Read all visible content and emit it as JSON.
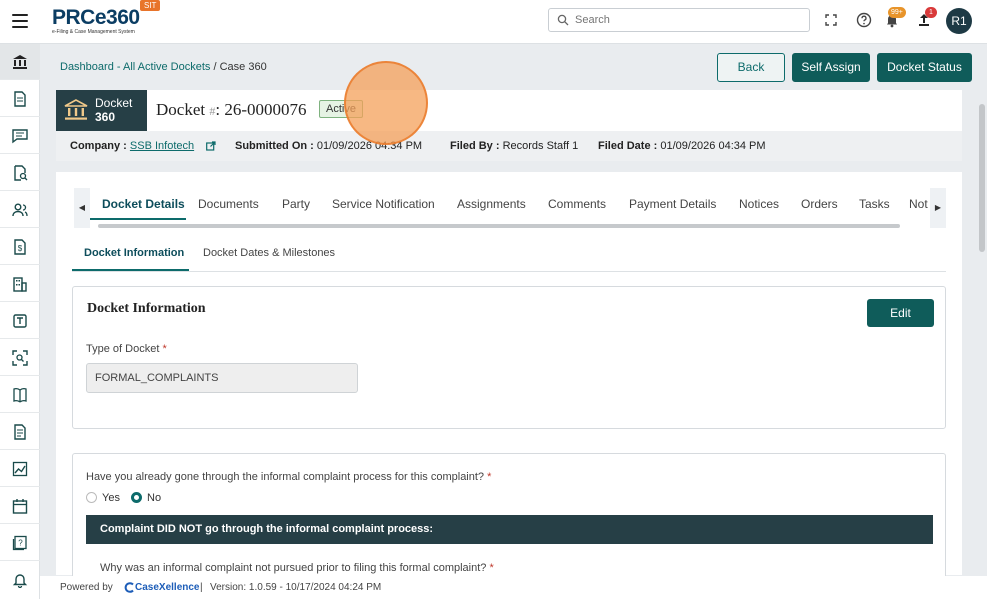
{
  "app": {
    "logo_text": "PRCe360",
    "logo_subtitle": "e-Filing & Case Management System",
    "env_badge": "SIT",
    "search_placeholder": "Search",
    "notifications_badge": "99+",
    "uploads_badge": "1",
    "user_initials": "R1"
  },
  "sidebar": {
    "items": [
      {
        "icon": "bank-icon",
        "active": true
      },
      {
        "icon": "document-icon"
      },
      {
        "icon": "chat-icon"
      },
      {
        "icon": "document-search-icon"
      },
      {
        "icon": "users-icon"
      },
      {
        "icon": "dollar-document-icon"
      },
      {
        "icon": "building-icon"
      },
      {
        "icon": "template-icon"
      },
      {
        "icon": "scan-search-icon"
      },
      {
        "icon": "book-icon"
      },
      {
        "icon": "file-text-icon"
      },
      {
        "icon": "chart-icon"
      },
      {
        "icon": "calendar-icon"
      },
      {
        "icon": "help-icon"
      },
      {
        "icon": "bell-icon"
      }
    ]
  },
  "breadcrumb": {
    "dashboard": "Dashboard",
    "sep1": " - ",
    "dockets": "All Active Dockets",
    "sep2": " / ",
    "current": "Case 360"
  },
  "actions": {
    "back": "Back",
    "self_assign": "Self Assign",
    "docket_status": "Docket Status"
  },
  "docket": {
    "tag_line1": "Docket",
    "tag_line2": "360",
    "title_prefix": "Docket ",
    "hash": "#",
    "title_sep": ": ",
    "number": "26-0000076",
    "status": "Active"
  },
  "meta": {
    "company_label": "Company :",
    "company_value": "SSB Infotech",
    "submitted_label": "Submitted On :",
    "submitted_value": "01/09/2026 04:34 PM",
    "filed_by_label": "Filed By :",
    "filed_by_value": "Records Staff 1",
    "filed_date_label": "Filed Date :",
    "filed_date_value": "01/09/2026 04:34 PM"
  },
  "tabs": [
    "Docket Details",
    "Documents",
    "Party",
    "Service Notification",
    "Assignments",
    "Comments",
    "Payment Details",
    "Notices",
    "Orders",
    "Tasks",
    "Not"
  ],
  "subtabs": [
    "Docket Information",
    "Docket Dates & Milestones"
  ],
  "docket_info": {
    "heading": "Docket Information",
    "edit": "Edit",
    "type_label": "Type of Docket",
    "required_mark": "*",
    "type_value": "FORMAL_COMPLAINTS"
  },
  "complaint": {
    "question": "Have you already gone through the informal complaint process for this complaint?",
    "required_mark": "*",
    "yes": "Yes",
    "no": "No",
    "selected": "No",
    "banner": "Complaint DID NOT go through the informal complaint process:",
    "sub_question": "Why was an informal complaint not pursued prior to filing this formal complaint?"
  },
  "footer": {
    "powered_by": "Powered by",
    "brand": "CaseXellence",
    "sep": "|",
    "version": "Version: 1.0.59 - 10/17/2024 04:24 PM"
  }
}
